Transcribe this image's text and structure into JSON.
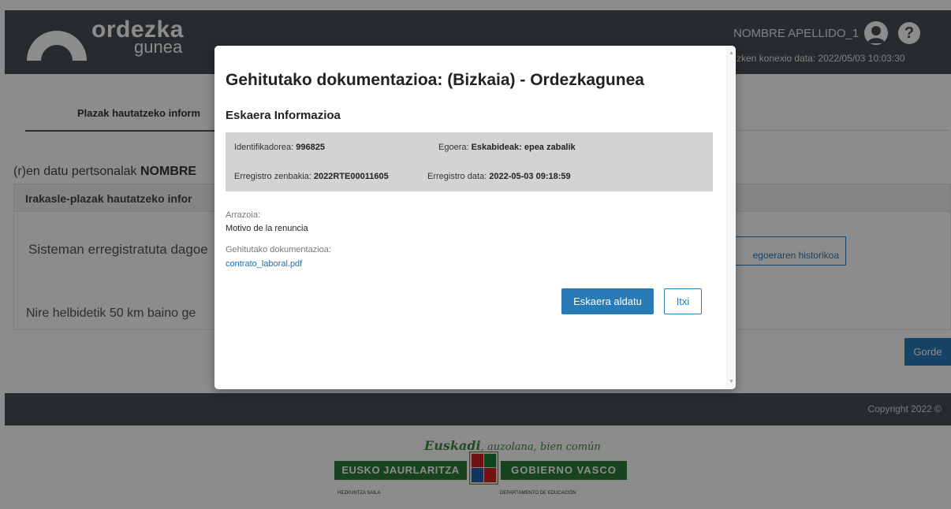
{
  "header": {
    "logo_word1": "ordezka",
    "logo_word2": "gunea",
    "user_name": "NOMBRE APELLIDO_1",
    "help_glyph": "?",
    "last_connection": "zken konexio data: 2022/05/03 10:03:30"
  },
  "tabs": {
    "active_label": "Plazak hautatzeko inform"
  },
  "main": {
    "personal_prefix": "(r)en datu pertsonalak ",
    "personal_name": "NOMBRE",
    "panel_title": "Irakasle-plazak hautatzeko infor",
    "row1_text": "Sisteman erregistratuta dagoe",
    "row2_text": "Nire helbidetik 50 km baino ge",
    "history_button": "egoeraren historikoa",
    "save_button": "Gorde"
  },
  "footer": {
    "copyright": "Copyright 2022 ©",
    "motto_word": "Euskadi",
    "motto_rest": ", auzolana, bien común",
    "gov_left": "EUSKO JAURLARITZA",
    "gov_right": "GOBIERNO VASCO",
    "dep_left": "HEZKUNTZA SAILA",
    "dep_right": "DEPARTAMENTO DE EDUCACIÓN"
  },
  "modal": {
    "title": "Gehitutako dokumentazioa: (Bizkaia) - Ordezkagunea",
    "section_title": "Eskaera Informazioa",
    "info": {
      "id_label": "Identifikadorea: ",
      "id_value": "996825",
      "status_label": "Egoera: ",
      "status_value": "Eskabideak: epea zabalik",
      "regnum_label": "Erregistro zenbakia: ",
      "regnum_value": "2022RTE00011605",
      "regdate_label": "Erregistro data: ",
      "regdate_value": "2022-05-03 09:18:59"
    },
    "reason_label": "Arrazoia:",
    "reason_value": "Motivo de la renuncia",
    "docs_label": "Gehitutako dokumentazioa:",
    "docs_file": "contrato_laboral.pdf",
    "primary_button": "Eskaera aldatu",
    "close_button": "Itxi"
  },
  "colors": {
    "header_bg": "#4a4f55",
    "primary": "#2a7ab8",
    "info_box_bg": "#d3d3d3"
  },
  "icons": {
    "avatar": "user-avatar-icon",
    "help": "help-icon",
    "scroll_up": "scroll-up-arrow-icon",
    "scroll_down": "scroll-down-arrow-icon"
  }
}
